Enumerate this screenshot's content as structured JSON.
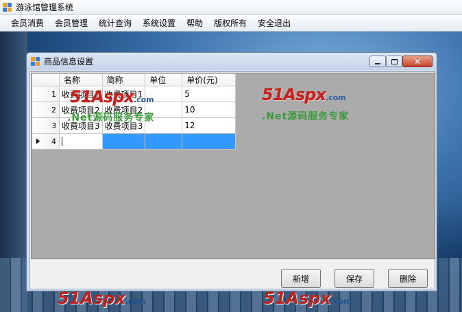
{
  "main_window": {
    "title": "游泳馆管理系统"
  },
  "menu": {
    "items": [
      "会员消费",
      "会员管理",
      "统计查询",
      "系统设置",
      "帮助",
      "版权所有",
      "安全退出"
    ]
  },
  "child_window": {
    "title": "商品信息设置"
  },
  "grid": {
    "columns": [
      "名称",
      "简称",
      "单位",
      "单价(元)"
    ],
    "rows": [
      {
        "num": "1",
        "name": "收费项目1",
        "short": "收费项目1",
        "unit": "",
        "price": "5"
      },
      {
        "num": "2",
        "name": "收费项目2",
        "short": "收费项目2",
        "unit": "",
        "price": "10"
      },
      {
        "num": "3",
        "name": "收费项目3",
        "short": "收费项目3",
        "unit": "",
        "price": "12"
      }
    ],
    "new_row_num": "4"
  },
  "buttons": {
    "add": "新增",
    "save": "保存",
    "delete": "删除"
  },
  "watermark": {
    "brand": "51Aspx",
    "domain": ".com",
    "slogan": ".Net源码服务专家"
  },
  "colors": {
    "selection": "#3399ff",
    "grid_background": "#ababab",
    "watermark_red": "#c2211d",
    "watermark_green": "#3b9a3b"
  }
}
